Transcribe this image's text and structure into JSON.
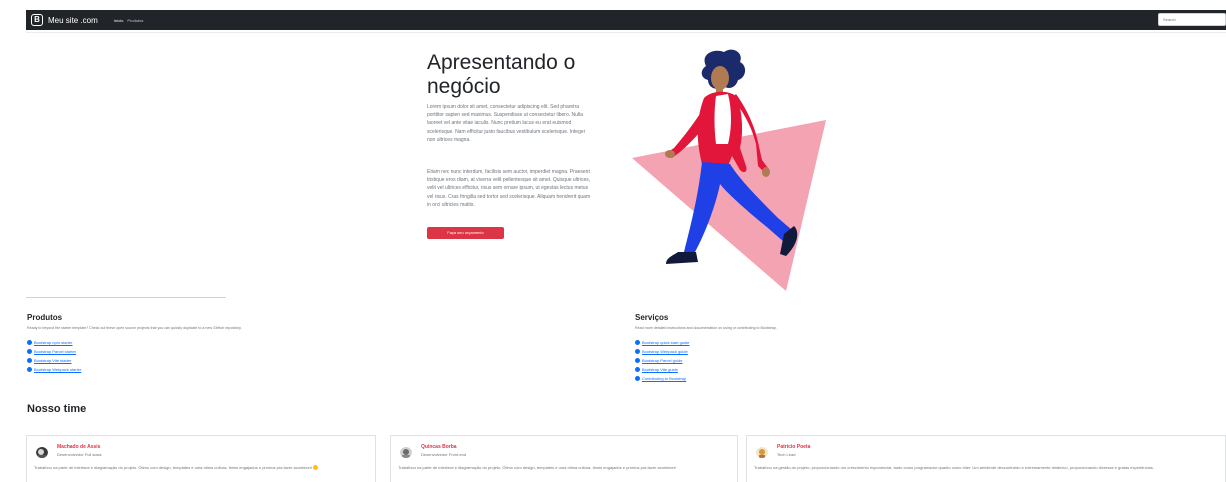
{
  "navbar": {
    "brand_logo": "B",
    "brand": "Meu site .com",
    "links": [
      "Início",
      "Produtos"
    ],
    "search_placeholder": "Search"
  },
  "hero": {
    "title": "Apresentando o negócio",
    "paragraph1": "Lorem ipsum dolor sit amet, consectetur adipiscing elit. Sed pharetra porttitor sapien sed maximus. Suspendisse ut consectetur libero. Nulla laoreet vel ante vitae iaculis. Nunc pretium lacus eu erat euismod scelerisque. Nam efficitur justo faucibus vestibulum scelerisque. Integer non ultrices magna.",
    "paragraph2": "Etiam nec nunc interdum, facilisis sem auctor, imperdiet magna. Praesent tristique eros diam, at viverra velit pellentesque sit amet. Quisque ultrices, velit vel ultrices efficitur, risus sem ornare ipsum, ut egestas lectus metus vel risus. Cras fringilla sed tortor sed scelerisque. Aliquam hendrerit quam in orci ultricies mattis.",
    "button": "Faça seu orçamento"
  },
  "products": {
    "title": "Produtos",
    "description": "Ready to beyond the starter template? Check out these open source projects that you can quickly duplicate to a new GitHub repository.",
    "links": [
      "Bootstrap npm starter",
      "Bootstrap Parcel starter",
      "Bootstrap Vite starter",
      "Bootstrap Webpack starter"
    ]
  },
  "services": {
    "title": "Serviços",
    "description": "Read more detailed instructions and documentation on using or contributing to Bootstrap.",
    "links": [
      "Bootstrap quick start guide",
      "Bootstrap Webpack guide",
      "Bootstrap Parcel guide",
      "Bootstrap Vite guide",
      "Contributing to Bootstrap"
    ]
  },
  "team": {
    "title": "Nosso time",
    "members": [
      {
        "name": "Machado de Assis",
        "role": "Desenvolvedor Full stack",
        "text": "Trabalhou na parte de interface e diagramação do projeto. Ótimo com design, templates e uma ótima cultura, times engajados e prontos pra fazer acontecer!"
      },
      {
        "name": "Quincas Borba",
        "role": "Desenvolvedor Front-end",
        "text": "Trabalhou na parte de interface e diagramação do projeto. Ótimo com design, templates e uma ótima cultura, times engajados e prontos pra fazer acontecer!"
      },
      {
        "name": "Patrício Poeta",
        "role": "Tech Lead",
        "text": "Trabalhou na gestão do projeto, proporcionando um crescimento exponencial, tanto como programador quanto como líder. Um ambiente descontraído e extremamente dinâmico, proporcionando diversas e gratas experiências."
      }
    ]
  },
  "colors": {
    "navbar": "#212529",
    "accent": "#dc3545",
    "link": "#0d6efd",
    "triangle": "#f4a3b3"
  }
}
